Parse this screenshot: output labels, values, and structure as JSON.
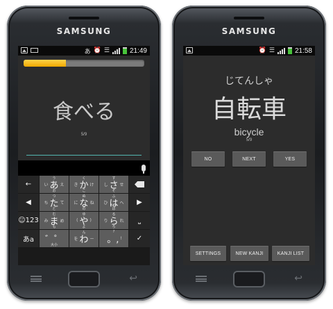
{
  "phones": {
    "brand": "SAMSUNG"
  },
  "left": {
    "status": {
      "ime_glyph": "あ",
      "time": "21:49"
    },
    "progress": 0.35,
    "word": "食べる",
    "counter": "5/9",
    "keyboard": {
      "keys": [
        {
          "name": "key-left-arrow",
          "label": "←",
          "type": "fn"
        },
        {
          "name": "key-a-row",
          "main": "あ",
          "left": "い",
          "right": "え",
          "top": "う",
          "bottom": "お",
          "type": "kana"
        },
        {
          "name": "key-ka-row",
          "main": "か",
          "left": "き",
          "right": "け",
          "top": "く",
          "bottom": "こ",
          "type": "kana"
        },
        {
          "name": "key-sa-row",
          "main": "さ",
          "left": "し",
          "right": "せ",
          "top": "す",
          "bottom": "そ",
          "type": "kana"
        },
        {
          "name": "key-delete",
          "label": "",
          "type": "del"
        },
        {
          "name": "key-prev",
          "label": "◀",
          "type": "fn"
        },
        {
          "name": "key-ta-row",
          "main": "た",
          "left": "ち",
          "right": "て",
          "top": "つ",
          "bottom": "と",
          "type": "kana"
        },
        {
          "name": "key-na-row",
          "main": "な",
          "left": "に",
          "right": "ね",
          "top": "ぬ",
          "bottom": "の",
          "type": "kana"
        },
        {
          "name": "key-ha-row",
          "main": "は",
          "left": "ひ",
          "right": "へ",
          "top": "ふ",
          "bottom": "ほ",
          "type": "kana"
        },
        {
          "name": "key-next",
          "label": "▶",
          "type": "fn"
        },
        {
          "name": "key-emoji-123",
          "label": "☺123",
          "type": "fn"
        },
        {
          "name": "key-ma-row",
          "main": "ま",
          "left": "み",
          "right": "め",
          "top": "む",
          "bottom": "も",
          "type": "kana"
        },
        {
          "name": "key-ya-row",
          "main": "や",
          "left": "(",
          "right": ")",
          "top": "ゆ",
          "bottom": "よ",
          "type": "kana"
        },
        {
          "name": "key-ra-row",
          "main": "ら",
          "left": "り",
          "right": "れ",
          "top": "る",
          "bottom": "ろ",
          "type": "kana"
        },
        {
          "name": "key-space",
          "label": "⎵",
          "type": "fn"
        },
        {
          "name": "key-mode-a",
          "label": "あa",
          "type": "fn"
        },
        {
          "name": "key-dakuten",
          "main": "゛゜",
          "left": "",
          "right": "",
          "top": "",
          "bottom": "大小",
          "type": "kana"
        },
        {
          "name": "key-wa-row",
          "main": "わ",
          "left": "を",
          "right": "ー",
          "top": "ん",
          "bottom": "",
          "type": "kana"
        },
        {
          "name": "key-punct",
          "main": "。,",
          "left": "",
          "right": "!",
          "top": "?",
          "bottom": "",
          "type": "kana"
        },
        {
          "name": "key-enter",
          "label": "✓",
          "type": "fn"
        }
      ]
    }
  },
  "right": {
    "status": {
      "time": "21:58"
    },
    "reading": "じてんしゃ",
    "kanji": "自転車",
    "meaning": "bicycle",
    "counter": "5/9",
    "buttons": {
      "no": "NO",
      "next": "NEXT",
      "yes": "YES",
      "settings": "SETTINGS",
      "new_kanji": "NEW KANJI",
      "kanji_list": "KANJI LIST"
    }
  },
  "colors": {
    "progress_fill": "#f2a900",
    "answer_line": "#53b7b0",
    "battery": "#48c43a"
  }
}
